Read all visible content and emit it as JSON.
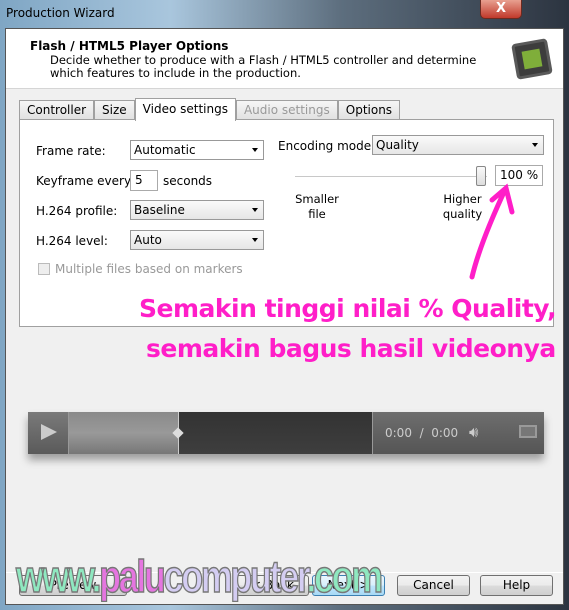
{
  "window": {
    "title": "Production Wizard",
    "close_label": "X"
  },
  "header": {
    "title": "Flash / HTML5 Player Options",
    "description": "Decide whether to produce with a Flash / HTML5 controller and determine which features to include in the production."
  },
  "tabs": [
    {
      "label": "Controller"
    },
    {
      "label": "Size"
    },
    {
      "label": "Video settings",
      "active": true
    },
    {
      "label": "Audio settings",
      "disabled": true
    },
    {
      "label": "Options"
    }
  ],
  "video": {
    "frame_rate_label": "Frame rate:",
    "frame_rate": "Automatic",
    "keyframe_label": "Keyframe every:",
    "keyframe": "5",
    "keyframe_unit": "seconds",
    "profile_label": "H.264 profile:",
    "profile": "Baseline",
    "level_label": "H.264 level:",
    "level": "Auto",
    "multiple_files_label": "Multiple files based on markers",
    "multiple_files_checked": false,
    "encoding_label": "Encoding mode:",
    "encoding": "Quality",
    "quality_percent": 100,
    "quality_value": "100 %",
    "smaller_label": "Smaller file",
    "higher_label": "Higher quality"
  },
  "annotation": {
    "line1": "Semakin tinggi nilai % Quality,",
    "line2": "semakin bagus hasil videonya",
    "color": "#ff1ec8"
  },
  "player": {
    "time": "0:00  /  0:00",
    "progress_fraction": 0.36
  },
  "watermark": {
    "part1": "www.",
    "part2": "palu",
    "part3": "computer",
    "part4": ".com"
  },
  "buttons": {
    "preview": "Preview",
    "back": "< Back",
    "next": "Next >",
    "cancel": "Cancel",
    "help": "Help"
  }
}
